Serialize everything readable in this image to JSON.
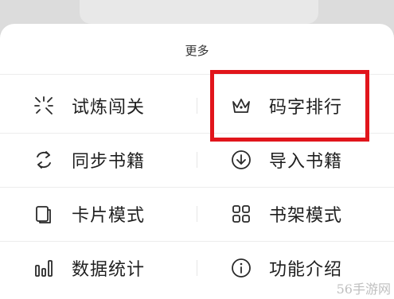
{
  "sheet": {
    "title": "更多"
  },
  "menu": {
    "rows": [
      {
        "left": {
          "label": "试炼闯关",
          "icon": "sparkle-icon"
        },
        "right": {
          "label": "码字排行",
          "icon": "crown-icon"
        }
      },
      {
        "left": {
          "label": "同步书籍",
          "icon": "sync-icon"
        },
        "right": {
          "label": "导入书籍",
          "icon": "download-circle-icon"
        }
      },
      {
        "left": {
          "label": "卡片模式",
          "icon": "card-icon"
        },
        "right": {
          "label": "书架模式",
          "icon": "grid-icon"
        }
      },
      {
        "left": {
          "label": "数据统计",
          "icon": "bar-chart-icon"
        },
        "right": {
          "label": "功能介绍",
          "icon": "info-icon"
        }
      }
    ]
  },
  "highlight": {
    "target": "码字排行",
    "color": "#e1151b"
  },
  "watermark": "56手游网"
}
